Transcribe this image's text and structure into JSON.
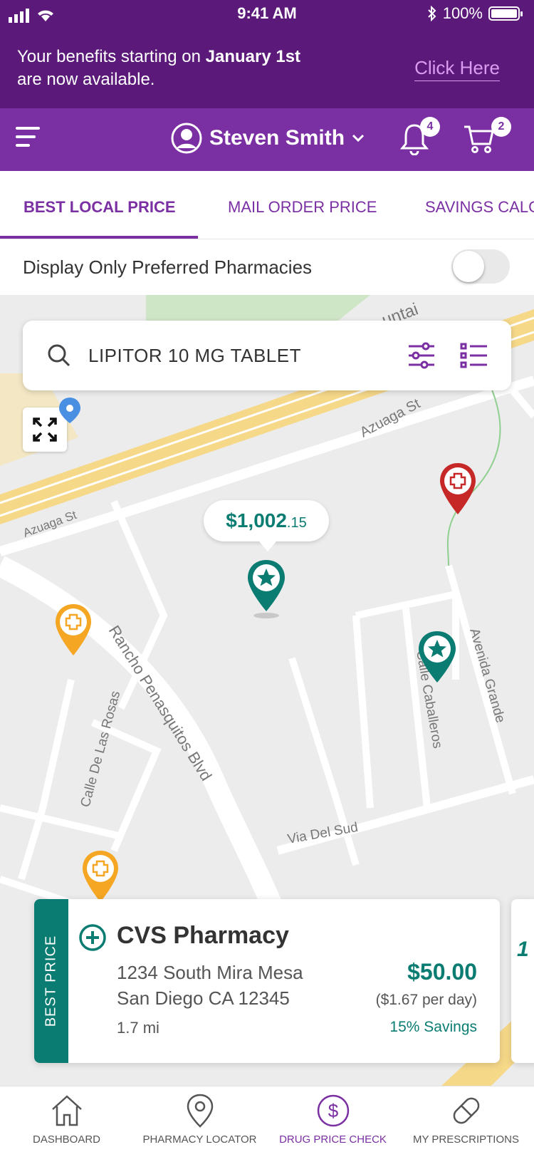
{
  "status_bar": {
    "time": "9:41 AM",
    "battery": "100%"
  },
  "banner": {
    "text_prefix": "Your benefits starting on ",
    "text_bold": "January 1st",
    "text_suffix": "are now available.",
    "link": "Click Here"
  },
  "header": {
    "user_name": "Steven Smith",
    "notifications_count": "4",
    "cart_count": "2"
  },
  "tabs": [
    {
      "label": "BEST LOCAL PRICE",
      "active": true
    },
    {
      "label": "MAIL ORDER PRICE",
      "active": false
    },
    {
      "label": "SAVINGS CALC",
      "active": false
    }
  ],
  "preferred_toggle": {
    "label": "Display Only Preferred Pharmacies",
    "on": false
  },
  "search": {
    "value": "LIPITOR 10 MG TABLET"
  },
  "map": {
    "street_labels": [
      "Azuaga St",
      "Azuaga St",
      "Rancho Penasquitos Blvd",
      "Calle De Las Rosas",
      "Calle Caballeros",
      "Avenida Grande",
      "Via Del Sud",
      "untai"
    ],
    "selected_price": {
      "dollars": "$1,002",
      "cents": ".15"
    }
  },
  "pharmacy_card": {
    "badge": "BEST PRICE",
    "name": "CVS Pharmacy",
    "address_line1": "1234 South Mira Mesa",
    "address_line2": "San Diego CA 12345",
    "distance": "1.7 mi",
    "price": "$50.00",
    "per_day": "($1.67 per day)",
    "savings": "15% Savings",
    "peek_text": "1"
  },
  "bottom_nav": [
    {
      "label": "DASHBOARD",
      "icon": "home-icon",
      "active": false
    },
    {
      "label": "PHARMACY LOCATOR",
      "icon": "location-pin-icon",
      "active": false
    },
    {
      "label": "DRUG PRICE CHECK",
      "icon": "dollar-circle-icon",
      "active": true
    },
    {
      "label": "MY PRESCRIPTIONS",
      "icon": "pill-icon",
      "active": false
    }
  ],
  "colors": {
    "brand_purple": "#7a2fa3",
    "banner_purple": "#5b1a7a",
    "teal": "#0a7c72",
    "orange_pin": "#f5a623",
    "red_pin": "#c62828"
  }
}
